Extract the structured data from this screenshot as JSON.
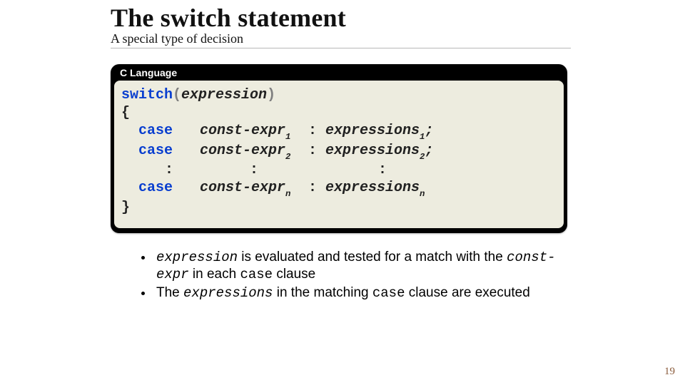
{
  "title": "The switch statement",
  "subtitle": "A special type of decision",
  "codebox": {
    "label": "C Language",
    "kw_switch": "switch",
    "paren_open": "(",
    "expr_head": "expression",
    "paren_close": ")",
    "brace_open": "{",
    "kw_case": "case",
    "const_expr": "const-expr",
    "sub1": "1",
    "sub2": "2",
    "subn": "n",
    "colon": ":",
    "expressions": "expressions",
    "semi": ";",
    "ellipsis": ":",
    "brace_close": "}"
  },
  "bullets": {
    "b1_p1": "expression",
    "b1_p2": " is evaluated and tested for a match with the ",
    "b1_p3": "const-expr",
    "b1_p4": " in each ",
    "b1_p5": "case",
    "b1_p6": " clause",
    "b2_p1": "The ",
    "b2_p2": "expressions",
    "b2_p3": " in the matching ",
    "b2_p4": "case",
    "b2_p5": " clause are executed"
  },
  "page_number": "19"
}
